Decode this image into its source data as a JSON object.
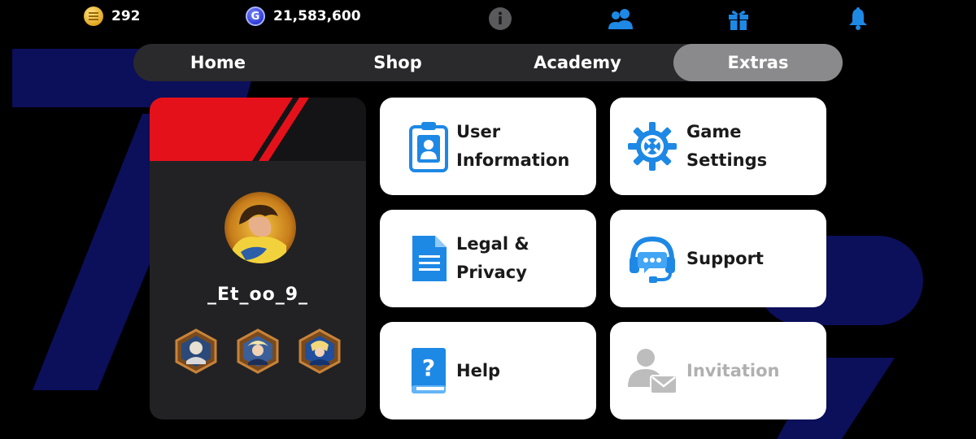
{
  "currencies": {
    "coins": "292",
    "gems": "21,583,600",
    "gem_symbol": "G"
  },
  "header_icons": [
    "info-icon",
    "friends-icon",
    "gift-icon",
    "bell-icon"
  ],
  "tabs": [
    {
      "label": "Home",
      "active": false
    },
    {
      "label": "Shop",
      "active": false
    },
    {
      "label": "Academy",
      "active": false
    },
    {
      "label": "Extras",
      "active": true
    }
  ],
  "profile": {
    "username": "_Et_oo_9_",
    "badges": [
      "badge-1",
      "badge-2",
      "badge-3"
    ]
  },
  "menu": [
    {
      "label": "User\nInformation",
      "icon": "id-card-icon",
      "enabled": true
    },
    {
      "label": "Game\nSettings",
      "icon": "settings-gear-icon",
      "enabled": true
    },
    {
      "label": "Legal &\nPrivacy",
      "icon": "document-icon",
      "enabled": true
    },
    {
      "label": "Support",
      "icon": "headset-icon",
      "enabled": true
    },
    {
      "label": "Help",
      "icon": "help-book-icon",
      "enabled": true
    },
    {
      "label": "Invitation",
      "icon": "invitation-icon",
      "enabled": false
    }
  ],
  "colors": {
    "accent_blue": "#1e88e5",
    "tab_active": "#8a8a8c",
    "tab_bar": "#2a2a2c",
    "banner_red": "#e4111b",
    "disabled_text": "#b0b0b0"
  }
}
